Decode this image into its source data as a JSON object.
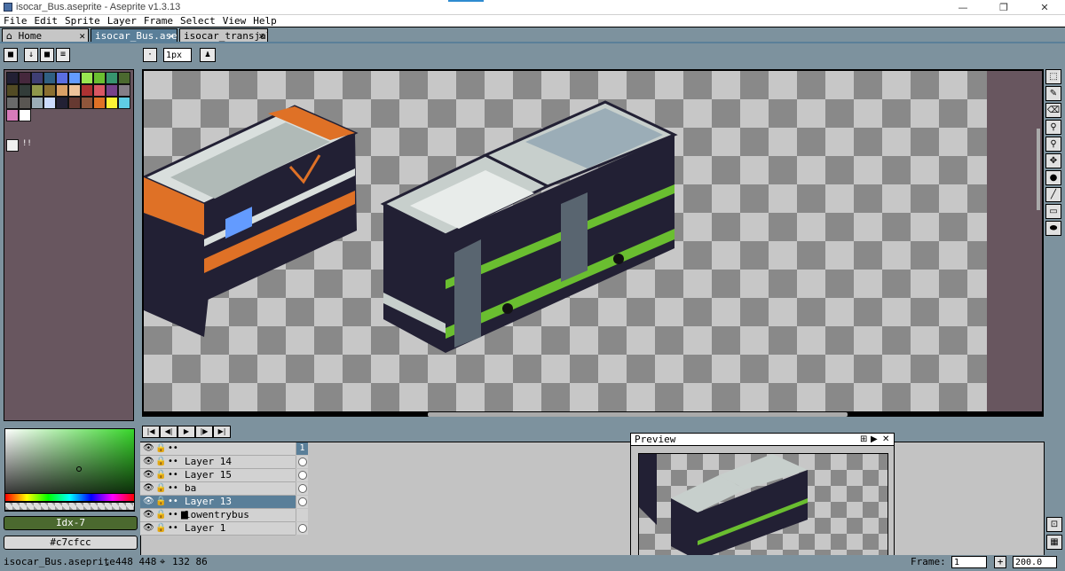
{
  "window": {
    "title": "isocar_Bus.aseprite - Aseprite v1.3.13",
    "minimize": "—",
    "maximize": "❐",
    "close": "✕"
  },
  "menu": [
    "File",
    "Edit",
    "Sprite",
    "Layer",
    "Frame",
    "Select",
    "View",
    "Help"
  ],
  "tabs": [
    {
      "label": "Home",
      "icon": "home-icon"
    },
    {
      "label": "isocar_Bus.asep",
      "active": true
    },
    {
      "label": "isocar_transjal"
    }
  ],
  "context_bar": {
    "brush_size": "1px",
    "brush_size_placeholder": "1px"
  },
  "palette": {
    "colors": [
      "#222034",
      "#45283c",
      "#3f3f74",
      "#306082",
      "#5b6ee1",
      "#639bff",
      "#99e550",
      "#6abe30",
      "#37946e",
      "#4b692f",
      "#524b24",
      "#323c39",
      "#8f974a",
      "#8a6f30",
      "#d9a066",
      "#eec39a",
      "#ac3232",
      "#d95763",
      "#76428a",
      "#847e87",
      "#696a6a",
      "#595652",
      "#9badb7",
      "#cbdbfc",
      "#222034",
      "#663931",
      "#8f563b",
      "#df7126",
      "#fbf236",
      "#5fcde4",
      "#d77bba",
      "#ffffff"
    ],
    "index_label": "!!",
    "fg_color": "#f0f0f0"
  },
  "color_panel": {
    "index_label": "Idx-7",
    "hex_label": "#c7cfcc",
    "accent": "#37d62a"
  },
  "timeline": {
    "layers": [
      {
        "name": "",
        "frame": "1",
        "is_header": true
      },
      {
        "name": "Layer 14"
      },
      {
        "name": "Layer 15"
      },
      {
        "name": "ba"
      },
      {
        "name": "Layer 13",
        "selected": true
      },
      {
        "name": "lowentrybus",
        "is_group": true
      },
      {
        "name": "Layer 1"
      }
    ]
  },
  "preview": {
    "title": "Preview"
  },
  "status": {
    "filename": "isocar_Bus.aseprite",
    "size": "448 448",
    "position": "132 86",
    "frame_label": "Frame:",
    "frame_value": "1",
    "zoom_value": "200.0"
  },
  "tools": [
    "marquee-icon",
    "pencil-icon",
    "eraser-icon",
    "eyedropper-icon",
    "zoom-icon",
    "move-icon",
    "fill-icon",
    "line-icon",
    "rectangle-icon",
    "ellipse-icon",
    "blur-icon"
  ],
  "accent_color": "#5a7f99",
  "canvas_bg": "#68565f"
}
